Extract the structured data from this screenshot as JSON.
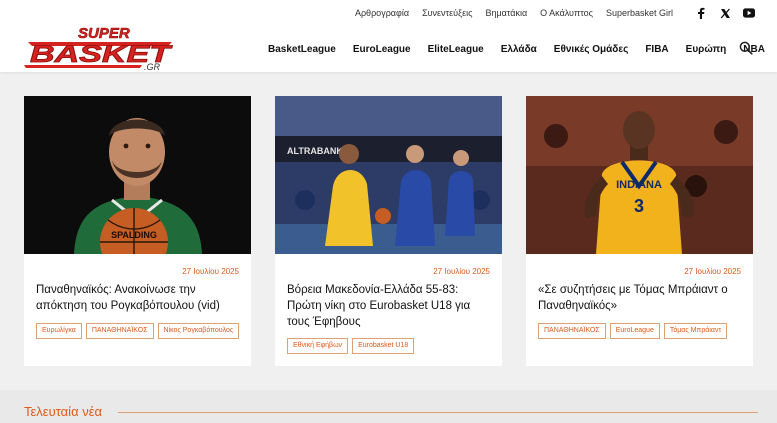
{
  "header": {
    "logo": {
      "line1": "SUPER",
      "line2": "BASKET",
      "suffix": ".GR"
    },
    "top_links": [
      "Αρθρογραφία",
      "Συνεντεύξεις",
      "Βηματάκια",
      "Ο Ακάλυπτος",
      "Superbasket Girl"
    ],
    "social_icons": [
      "facebook-icon",
      "x-icon",
      "youtube-icon"
    ],
    "main_links": [
      "BasketLeague",
      "EuroLeague",
      "EliteLeague",
      "Ελλάδα",
      "Εθνικές Ομάδες",
      "FIBA",
      "Ευρώπη",
      "NBA"
    ],
    "search_icon": "search-icon"
  },
  "cards": [
    {
      "date": "27 Ιουλίου 2025",
      "title": "Παναθηναϊκός: Ανακοίνωσε την απόκτηση του Ρογκαβόπουλου (vid)",
      "tags": [
        "Ευρωλίγκα",
        "ΠΑΝΑΘΗΝΑΪΚΟΣ",
        "Νίκος Ρογκαβόπουλος"
      ],
      "image_text": "SPALDING"
    },
    {
      "date": "27 Ιουλίου 2025",
      "title": "Βόρεια Μακεδονία-Ελλάδα 55-83: Πρώτη νίκη στο Eurobasket U18 για τους Έφηβους",
      "tags": [
        "Εθνική Εφήβων",
        "Eurobasket U18"
      ],
      "image_text": "ALTRABANK"
    },
    {
      "date": "27 Ιουλίου 2025",
      "title": "«Σε συζητήσεις με Τόμας Μπράιαντ ο Παναθηναϊκός»",
      "tags": [
        "ΠΑΝΑΘΗΝΑΪΚΟΣ",
        "EuroLeague",
        "Τόμας Μπράιαντ"
      ],
      "image_text": "INDIANA"
    }
  ],
  "latest": {
    "title": "Τελευταία νέα"
  },
  "colors": {
    "accent": "#e0581a",
    "logo_red": "#d7231f",
    "panathinaikos_green": "#1f6b3a",
    "indiana_gold": "#f2b21b"
  }
}
